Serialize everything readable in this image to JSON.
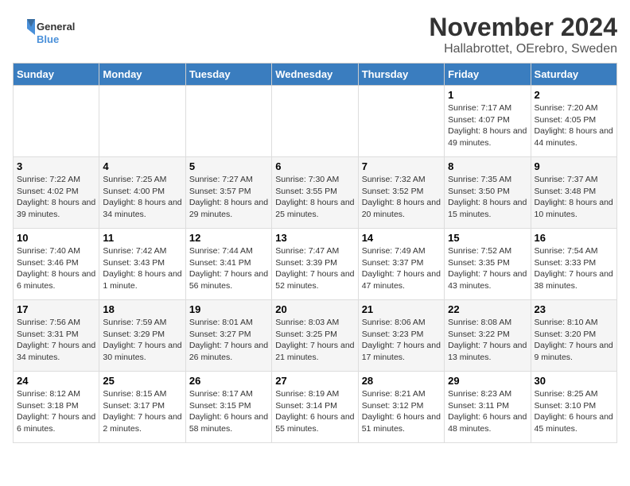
{
  "header": {
    "logo_general": "General",
    "logo_blue": "Blue",
    "month": "November 2024",
    "location": "Hallabrottet, OErebro, Sweden"
  },
  "days_of_week": [
    "Sunday",
    "Monday",
    "Tuesday",
    "Wednesday",
    "Thursday",
    "Friday",
    "Saturday"
  ],
  "weeks": [
    [
      {
        "day": "",
        "info": ""
      },
      {
        "day": "",
        "info": ""
      },
      {
        "day": "",
        "info": ""
      },
      {
        "day": "",
        "info": ""
      },
      {
        "day": "",
        "info": ""
      },
      {
        "day": "1",
        "info": "Sunrise: 7:17 AM\nSunset: 4:07 PM\nDaylight: 8 hours and 49 minutes."
      },
      {
        "day": "2",
        "info": "Sunrise: 7:20 AM\nSunset: 4:05 PM\nDaylight: 8 hours and 44 minutes."
      }
    ],
    [
      {
        "day": "3",
        "info": "Sunrise: 7:22 AM\nSunset: 4:02 PM\nDaylight: 8 hours and 39 minutes."
      },
      {
        "day": "4",
        "info": "Sunrise: 7:25 AM\nSunset: 4:00 PM\nDaylight: 8 hours and 34 minutes."
      },
      {
        "day": "5",
        "info": "Sunrise: 7:27 AM\nSunset: 3:57 PM\nDaylight: 8 hours and 29 minutes."
      },
      {
        "day": "6",
        "info": "Sunrise: 7:30 AM\nSunset: 3:55 PM\nDaylight: 8 hours and 25 minutes."
      },
      {
        "day": "7",
        "info": "Sunrise: 7:32 AM\nSunset: 3:52 PM\nDaylight: 8 hours and 20 minutes."
      },
      {
        "day": "8",
        "info": "Sunrise: 7:35 AM\nSunset: 3:50 PM\nDaylight: 8 hours and 15 minutes."
      },
      {
        "day": "9",
        "info": "Sunrise: 7:37 AM\nSunset: 3:48 PM\nDaylight: 8 hours and 10 minutes."
      }
    ],
    [
      {
        "day": "10",
        "info": "Sunrise: 7:40 AM\nSunset: 3:46 PM\nDaylight: 8 hours and 6 minutes."
      },
      {
        "day": "11",
        "info": "Sunrise: 7:42 AM\nSunset: 3:43 PM\nDaylight: 8 hours and 1 minute."
      },
      {
        "day": "12",
        "info": "Sunrise: 7:44 AM\nSunset: 3:41 PM\nDaylight: 7 hours and 56 minutes."
      },
      {
        "day": "13",
        "info": "Sunrise: 7:47 AM\nSunset: 3:39 PM\nDaylight: 7 hours and 52 minutes."
      },
      {
        "day": "14",
        "info": "Sunrise: 7:49 AM\nSunset: 3:37 PM\nDaylight: 7 hours and 47 minutes."
      },
      {
        "day": "15",
        "info": "Sunrise: 7:52 AM\nSunset: 3:35 PM\nDaylight: 7 hours and 43 minutes."
      },
      {
        "day": "16",
        "info": "Sunrise: 7:54 AM\nSunset: 3:33 PM\nDaylight: 7 hours and 38 minutes."
      }
    ],
    [
      {
        "day": "17",
        "info": "Sunrise: 7:56 AM\nSunset: 3:31 PM\nDaylight: 7 hours and 34 minutes."
      },
      {
        "day": "18",
        "info": "Sunrise: 7:59 AM\nSunset: 3:29 PM\nDaylight: 7 hours and 30 minutes."
      },
      {
        "day": "19",
        "info": "Sunrise: 8:01 AM\nSunset: 3:27 PM\nDaylight: 7 hours and 26 minutes."
      },
      {
        "day": "20",
        "info": "Sunrise: 8:03 AM\nSunset: 3:25 PM\nDaylight: 7 hours and 21 minutes."
      },
      {
        "day": "21",
        "info": "Sunrise: 8:06 AM\nSunset: 3:23 PM\nDaylight: 7 hours and 17 minutes."
      },
      {
        "day": "22",
        "info": "Sunrise: 8:08 AM\nSunset: 3:22 PM\nDaylight: 7 hours and 13 minutes."
      },
      {
        "day": "23",
        "info": "Sunrise: 8:10 AM\nSunset: 3:20 PM\nDaylight: 7 hours and 9 minutes."
      }
    ],
    [
      {
        "day": "24",
        "info": "Sunrise: 8:12 AM\nSunset: 3:18 PM\nDaylight: 7 hours and 6 minutes."
      },
      {
        "day": "25",
        "info": "Sunrise: 8:15 AM\nSunset: 3:17 PM\nDaylight: 7 hours and 2 minutes."
      },
      {
        "day": "26",
        "info": "Sunrise: 8:17 AM\nSunset: 3:15 PM\nDaylight: 6 hours and 58 minutes."
      },
      {
        "day": "27",
        "info": "Sunrise: 8:19 AM\nSunset: 3:14 PM\nDaylight: 6 hours and 55 minutes."
      },
      {
        "day": "28",
        "info": "Sunrise: 8:21 AM\nSunset: 3:12 PM\nDaylight: 6 hours and 51 minutes."
      },
      {
        "day": "29",
        "info": "Sunrise: 8:23 AM\nSunset: 3:11 PM\nDaylight: 6 hours and 48 minutes."
      },
      {
        "day": "30",
        "info": "Sunrise: 8:25 AM\nSunset: 3:10 PM\nDaylight: 6 hours and 45 minutes."
      }
    ]
  ]
}
